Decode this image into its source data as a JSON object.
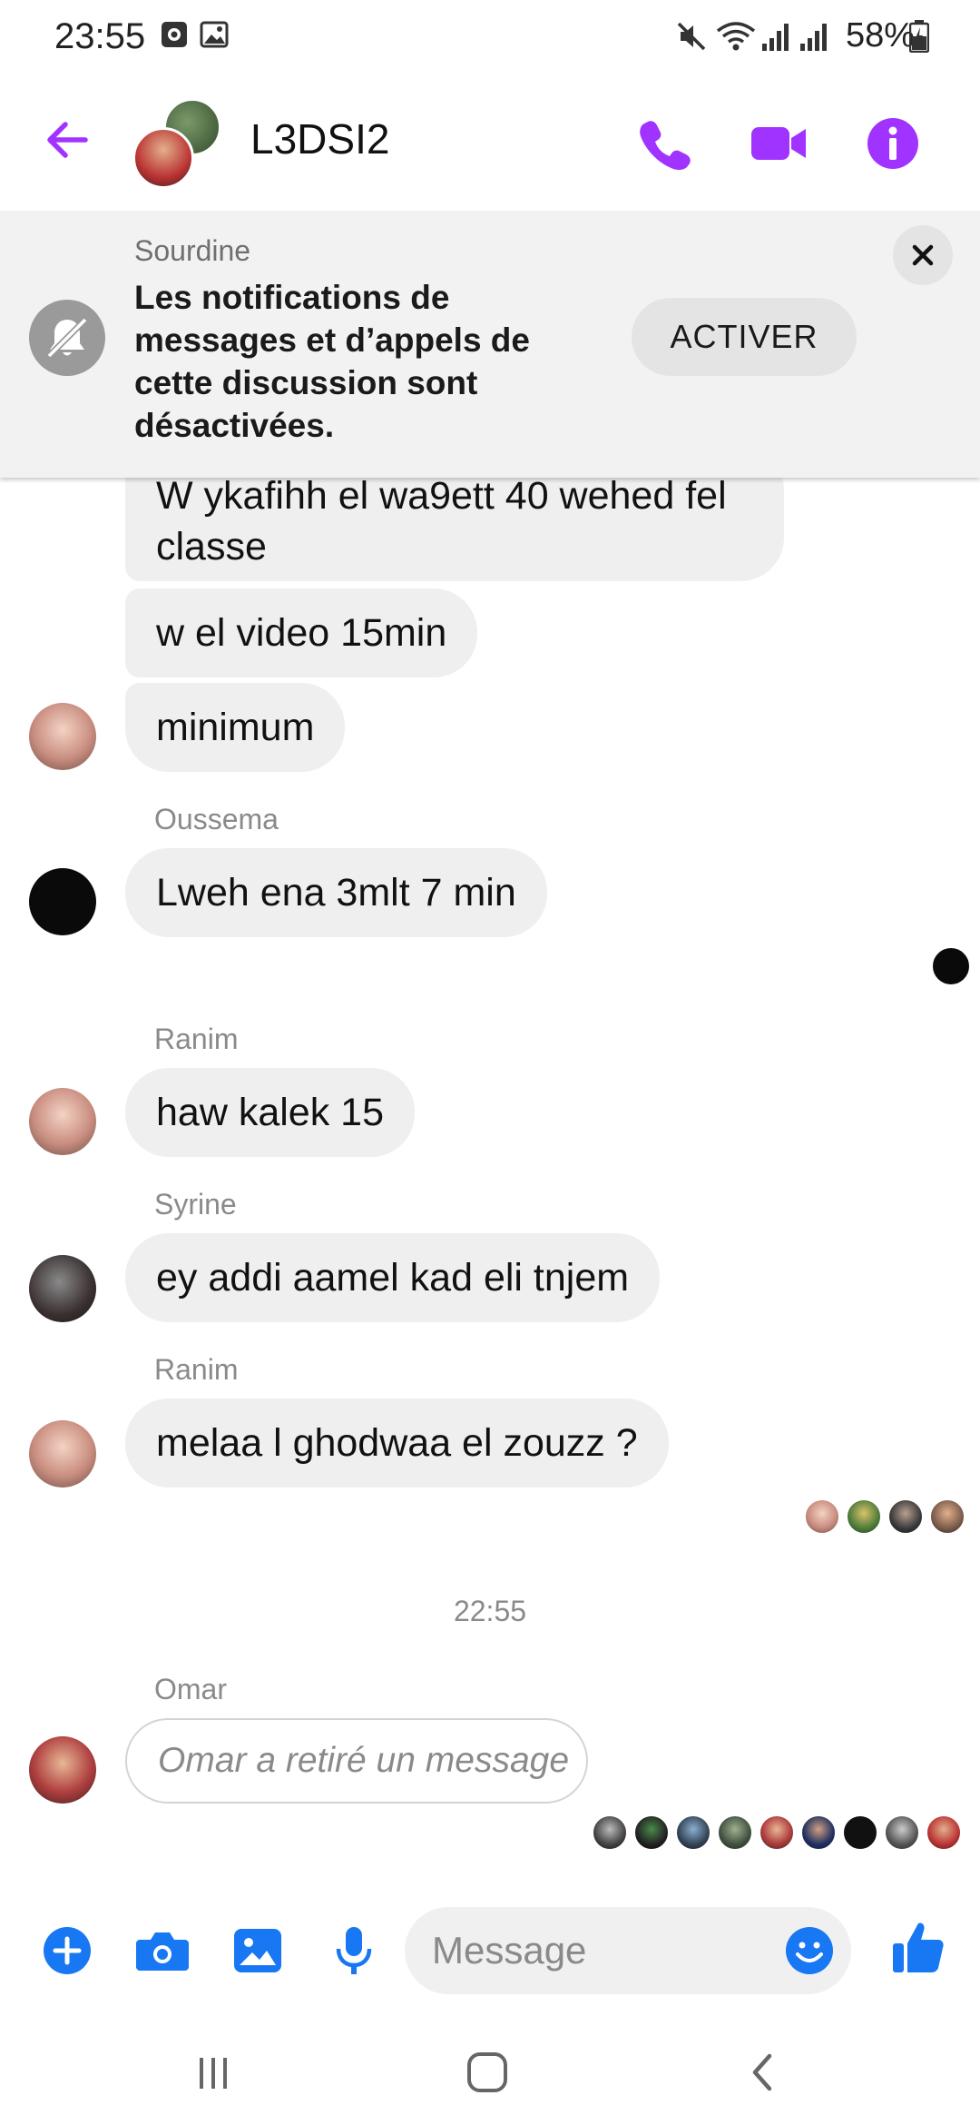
{
  "status_bar": {
    "time": "23:55",
    "battery": "58%"
  },
  "header": {
    "title": "L3DSI2"
  },
  "mute_banner": {
    "title": "Sourdine",
    "text": "Les notifications de messages et d’appels de cette discussion sont désactivées.",
    "activate_label": "ACTIVER"
  },
  "messages": [
    {
      "text": "W ykafihh el wa9ett 40 wehed fel classe"
    },
    {
      "text": "w el video 15min"
    },
    {
      "text": "minimum"
    },
    {
      "sender": "Oussema",
      "text": "Lweh ena 3mlt 7 min"
    },
    {
      "sender": "Ranim",
      "text": "haw kalek 15"
    },
    {
      "sender": "Syrine",
      "text": "ey addi aamel kad eli tnjem"
    },
    {
      "sender": "Ranim",
      "text": "melaa l ghodwaa el zouzz ?"
    },
    {
      "sender": "Omar",
      "text": "Omar a retiré un message"
    }
  ],
  "time_separator": "22:55",
  "composer": {
    "placeholder": "Message"
  },
  "colors": {
    "accent": "#a033ff",
    "messenger_blue": "#1877f2",
    "bubble": "#efefef"
  },
  "icons": [
    "back-arrow-icon",
    "phone-icon",
    "video-icon",
    "info-icon",
    "muted-bell-icon",
    "close-icon",
    "plus-icon",
    "camera-icon",
    "gallery-icon",
    "mic-icon",
    "emoji-icon",
    "like-icon"
  ]
}
